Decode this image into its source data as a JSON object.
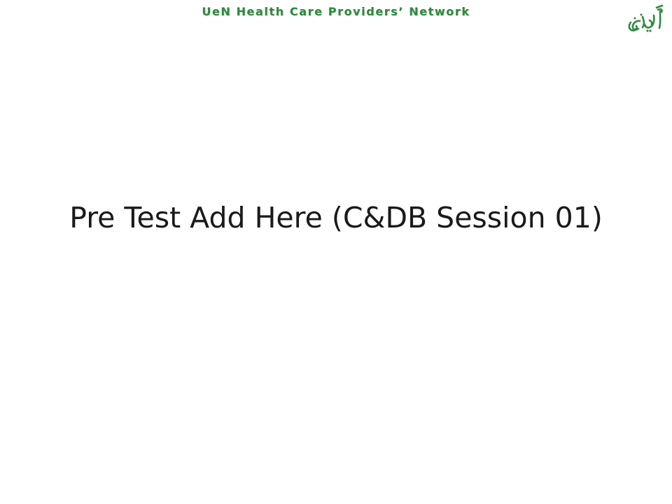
{
  "slide": {
    "header_title": "UeN Health Care Providers’ Network",
    "main_title": "Pre Test Add Here (C&DB Session 01)",
    "logo": {
      "icon": "umeed-no-calligraphy-logo",
      "color": "#2e8b3c"
    }
  },
  "colors": {
    "header_green": "#2e8b3c",
    "title_text": "#1a1a1a",
    "background": "#ffffff"
  }
}
